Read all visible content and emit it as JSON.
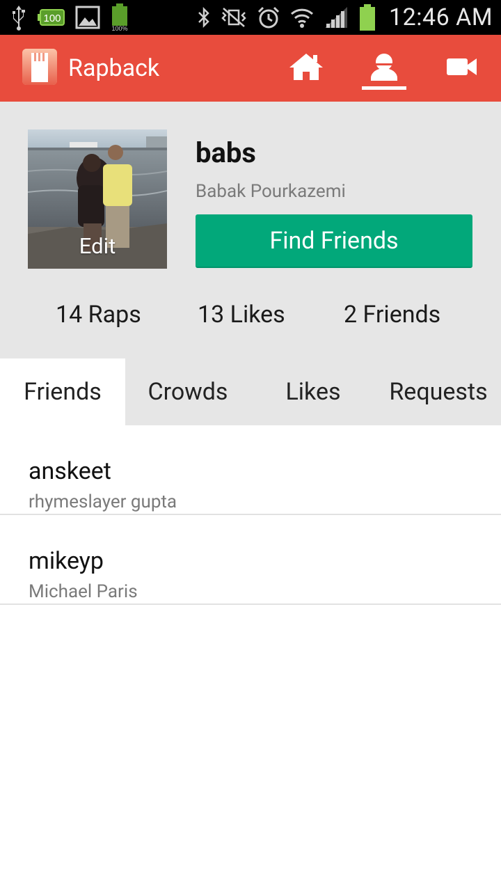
{
  "status_bar": {
    "time": "12:46 AM",
    "battery_text": "100",
    "battery_percent_text": "100%",
    "icons": [
      "usb-icon",
      "battery-saver-icon",
      "gallery-icon",
      "battery-icon",
      "bluetooth-icon",
      "vibrate-icon",
      "alarm-icon",
      "wifi-icon",
      "signal-icon",
      "battery-charging-icon"
    ]
  },
  "app_bar": {
    "title": "Rapback",
    "nav": [
      {
        "name": "home",
        "icon": "home-icon"
      },
      {
        "name": "profile",
        "icon": "profile-icon",
        "active": true
      },
      {
        "name": "video",
        "icon": "video-camera-icon"
      }
    ],
    "colors": {
      "accent": "#e84c3d"
    }
  },
  "profile": {
    "username": "babs",
    "full_name": "Babak Pourkazemi",
    "avatar_edit_label": "Edit",
    "find_friends_label": "Find Friends",
    "stats": {
      "raps": "14 Raps",
      "likes": "13 Likes",
      "friends": "2 Friends"
    },
    "colors": {
      "button": "#02a87a"
    }
  },
  "tabs": [
    {
      "label": "Friends",
      "active": true
    },
    {
      "label": "Crowds",
      "active": false
    },
    {
      "label": "Likes",
      "active": false
    },
    {
      "label": "Requests",
      "active": false
    }
  ],
  "friends": [
    {
      "handle": "anskeet",
      "name": "rhymeslayer gupta"
    },
    {
      "handle": "mikeyp",
      "name": "Michael Paris"
    }
  ]
}
